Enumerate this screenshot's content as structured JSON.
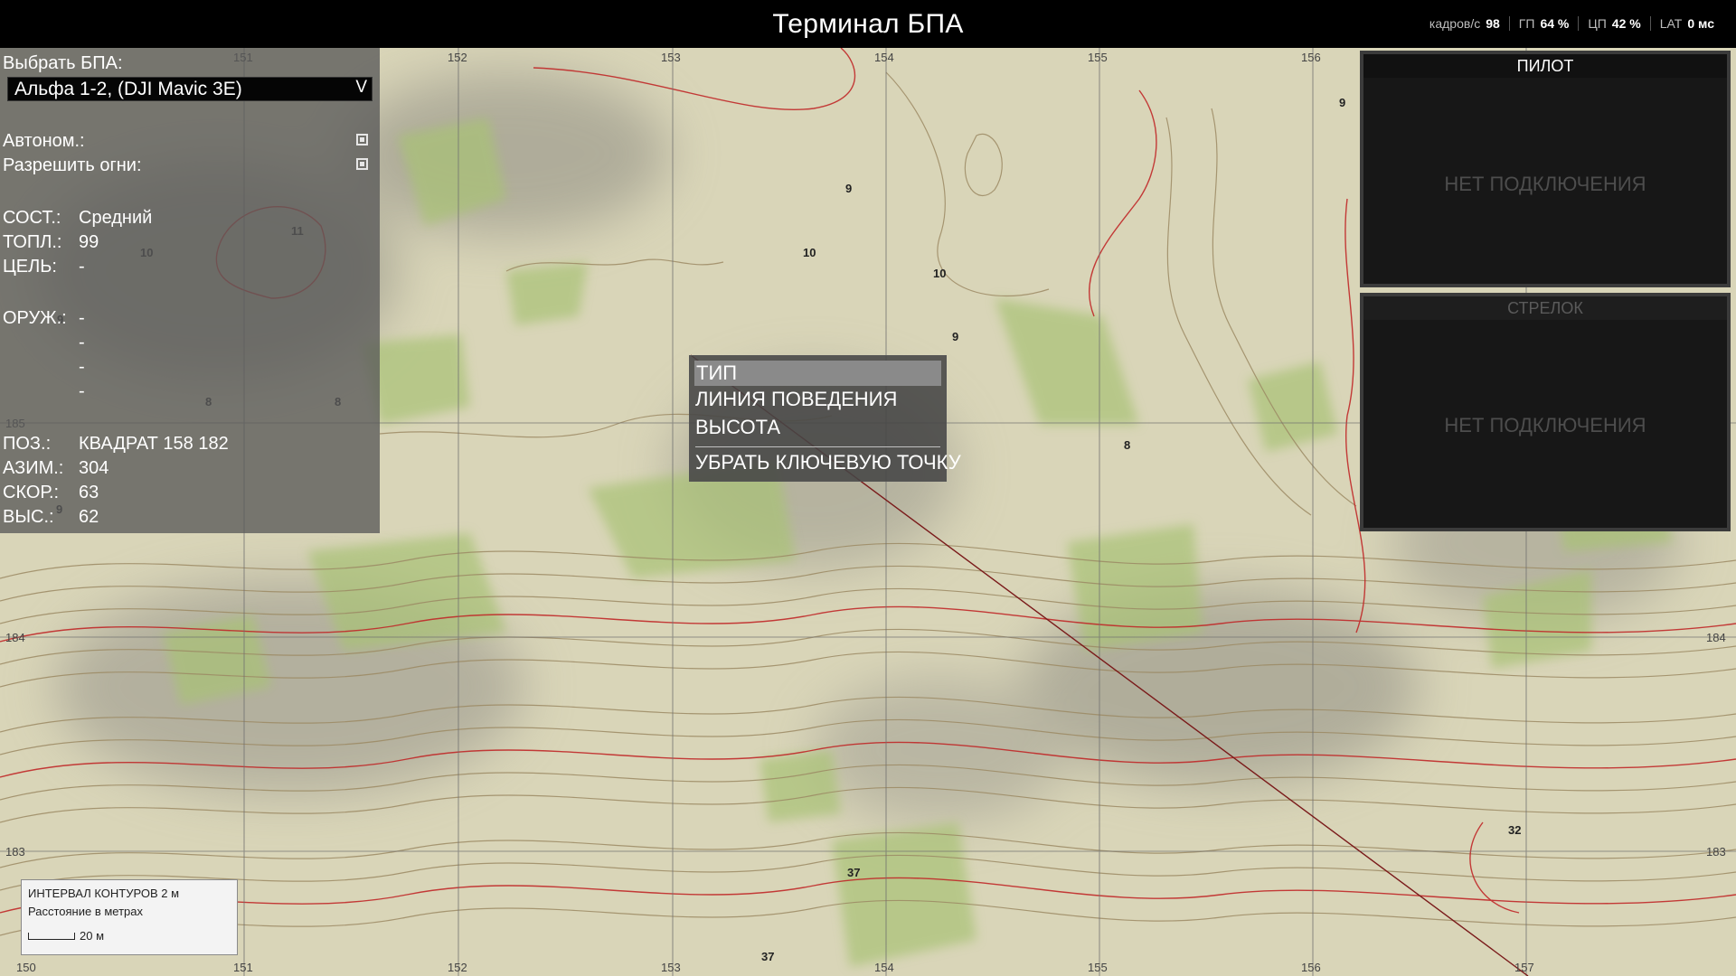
{
  "header": {
    "title": "Терминал БПА",
    "stats": [
      {
        "label": "кадров/с",
        "value": "98"
      },
      {
        "label": "ГП",
        "value": "64 %"
      },
      {
        "label": "ЦП",
        "value": "42 %"
      },
      {
        "label": "LAT",
        "value": "0 мс"
      }
    ]
  },
  "panel": {
    "select_label": "Выбрать БПА:",
    "selected_uav": "Альфа 1-2, (DJI Mavic 3E)",
    "dropdown_arrow": "V",
    "autonomous_label": "Автоном.:",
    "allow_fire_label": "Разрешить огни:",
    "state_label": "СОСТ.:",
    "state_value": "Средний",
    "fuel_label": "ТОПЛ.:",
    "fuel_value": "99",
    "target_label": "ЦЕЛЬ:",
    "target_value": "-",
    "weapons_label": "ОРУЖ.:",
    "weapons": [
      "-",
      "-",
      "-",
      "-"
    ],
    "pos_label": "ПОЗ.:",
    "pos_value": "КВАДРАТ 158 182",
    "azimuth_label": "АЗИМ.:",
    "azimuth_value": "304",
    "speed_label": "СКОР.:",
    "speed_value": "63",
    "alt_label": "ВЫС.:",
    "alt_value": "62"
  },
  "context_menu": {
    "items": [
      "ТИП",
      "ЛИНИЯ ПОВЕДЕНИЯ",
      "ВЫСОТА"
    ],
    "remove": "УБРАТЬ КЛЮЧЕВУЮ ТОЧКУ"
  },
  "feeds": {
    "pilot_title": "ПИЛОТ",
    "pilot_status": "НЕТ ПОДКЛЮЧЕНИЯ",
    "gunner_title": "СТРЕЛОК",
    "gunner_status": "НЕТ ПОДКЛЮЧЕНИЯ"
  },
  "map": {
    "grid_x_labels": [
      "150",
      "151",
      "152",
      "153",
      "154",
      "155",
      "156",
      "157"
    ],
    "grid_y_labels": [
      "185",
      "184",
      "183"
    ],
    "spot_heights": [
      "9",
      "10",
      "11",
      "10",
      "9",
      "10",
      "8",
      "8",
      "9",
      "9",
      "9",
      "8",
      "9",
      "37",
      "37",
      "32"
    ],
    "colors": {
      "terrain": "#d8d4b6",
      "vegetation": "#a9c276",
      "contour": "#9c8a64",
      "major_contour": "#c02828",
      "route": "#7a1a1a"
    }
  },
  "legend": {
    "interval": "ИНТЕРВАЛ КОНТУРОВ 2 м",
    "units": "Расстояние в метрах",
    "scale": "20 м"
  }
}
